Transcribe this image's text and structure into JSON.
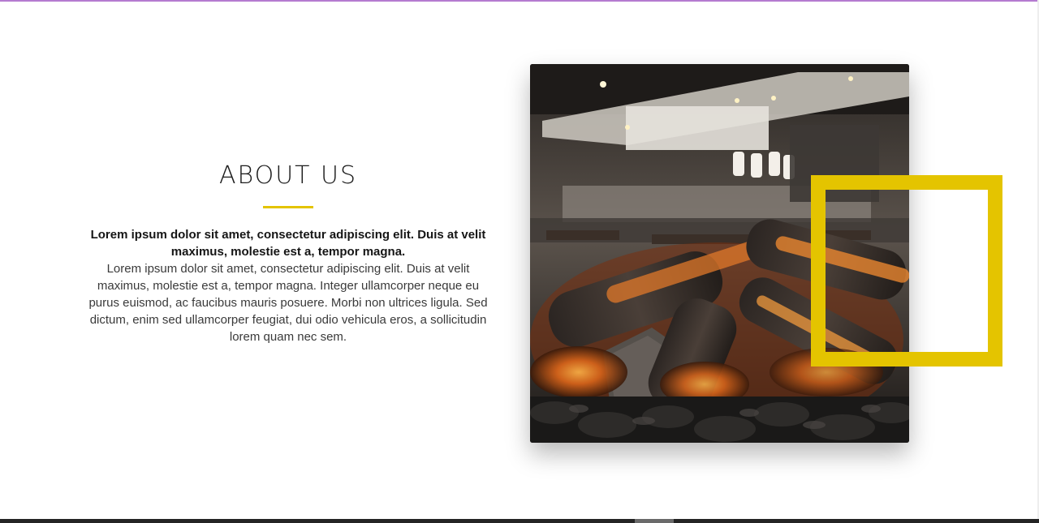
{
  "about": {
    "title": "ABOUT US",
    "lead": "Lorem ipsum dolor sit amet, consectetur adipiscing elit. Duis at velit maximus, molestie est a, tempor magna.",
    "body": "Lorem ipsum dolor sit amet, consectetur adipiscing elit. Duis at velit maximus, molestie est a, tempor magna. Integer ullamcorper neque eu purus euismod, ac faucibus mauris posuere. Morbi non ultrices ligula. Sed dictum, enim sed ullamcorper feugiat, dui odio vehicula eros, a sollicitudin lorem quam nec sem."
  },
  "media": {
    "image_icon": "restaurant-fireplace-photo-icon",
    "frame_icon": "square-frame-decoration-icon"
  },
  "colors": {
    "accent": "#e4c400",
    "heading": "#1c1c1c",
    "body": "#3a3a3a",
    "top_line": "#b57bd0",
    "footer": "#242424"
  }
}
